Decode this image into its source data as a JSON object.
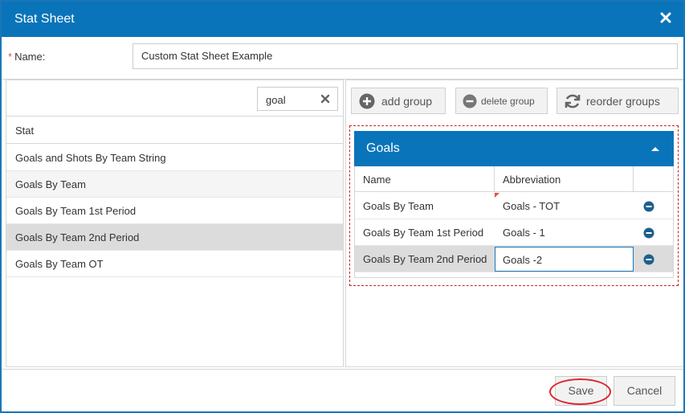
{
  "dialog": {
    "title": "Stat Sheet",
    "close_icon": "close-icon"
  },
  "name_field": {
    "required_mark": "*",
    "label": "Name:",
    "value": "Custom Stat Sheet Example"
  },
  "left_pane": {
    "search": {
      "value": "goal",
      "clear_icon": "clear-icon"
    },
    "column_header": "Stat",
    "items": [
      "Goals and Shots By Team String",
      "Goals By Team",
      "Goals By Team 1st Period",
      "Goals By Team 2nd Period",
      "Goals By Team OT"
    ],
    "selected_index": 3
  },
  "toolbar": {
    "add_group": "add group",
    "delete_group": "delete group",
    "reorder_groups": "reorder groups"
  },
  "group": {
    "title": "Goals",
    "columns": [
      "Name",
      "Abbreviation"
    ],
    "rows": [
      {
        "name": "Goals By Team",
        "abbreviation": "Goals - TOT"
      },
      {
        "name": "Goals By Team 1st Period",
        "abbreviation": "Goals - 1"
      },
      {
        "name": "Goals By Team 2nd Period",
        "abbreviation": "Goals -2"
      }
    ]
  },
  "footer": {
    "save": "Save",
    "cancel": "Cancel"
  },
  "colors": {
    "accent": "#0a74ba",
    "highlight_ring": "#d9282f",
    "required": "#d9534f"
  }
}
